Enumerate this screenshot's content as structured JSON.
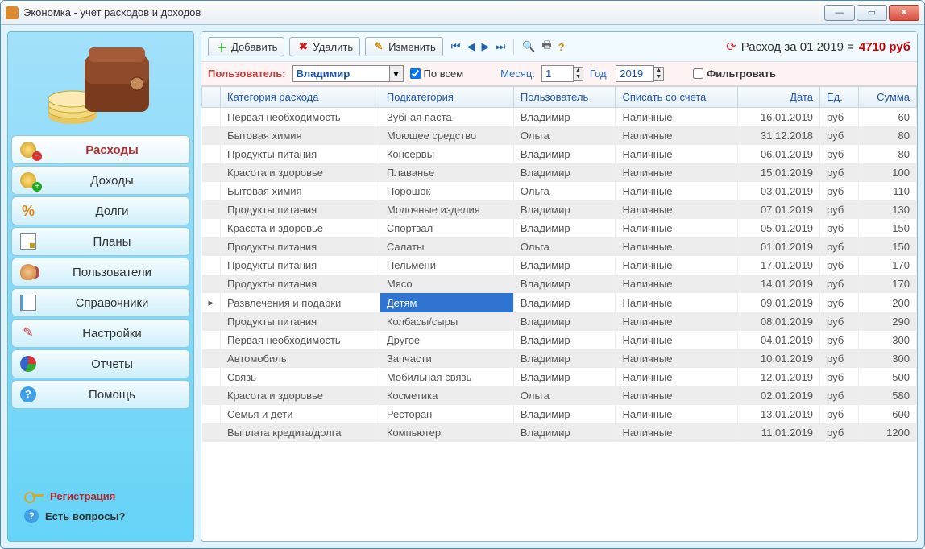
{
  "window": {
    "title": "Экономка - учет расходов и доходов"
  },
  "sidebar": {
    "items": [
      {
        "label": "Расходы",
        "icon": "coins-minus-icon",
        "active": true
      },
      {
        "label": "Доходы",
        "icon": "coins-plus-icon",
        "active": false
      },
      {
        "label": "Долги",
        "icon": "percent-icon",
        "active": false
      },
      {
        "label": "Планы",
        "icon": "document-icon",
        "active": false
      },
      {
        "label": "Пользователи",
        "icon": "users-icon",
        "active": false
      },
      {
        "label": "Справочники",
        "icon": "book-icon",
        "active": false
      },
      {
        "label": "Настройки",
        "icon": "tools-icon",
        "active": false
      },
      {
        "label": "Отчеты",
        "icon": "pie-chart-icon",
        "active": false
      },
      {
        "label": "Помощь",
        "icon": "help-icon",
        "active": false
      }
    ],
    "registration_label": "Регистрация",
    "questions_label": "Есть вопросы?"
  },
  "toolbar": {
    "add_label": "Добавить",
    "delete_label": "Удалить",
    "edit_label": "Изменить",
    "summary_prefix": "Расход за 01.2019 = ",
    "summary_amount": "4710 руб"
  },
  "filter": {
    "user_label": "Пользователь:",
    "user_value": "Владимир",
    "all_label": "По всем",
    "all_checked": true,
    "month_label": "Месяц:",
    "month_value": "1",
    "year_label": "Год:",
    "year_value": "2019",
    "filter_label": "Фильтровать",
    "filter_checked": false
  },
  "table": {
    "columns": [
      "Категория расхода",
      "Подкатегория",
      "Пользователь",
      "Списать со счета",
      "Дата",
      "Ед.",
      "Сумма"
    ],
    "selected_index": 10,
    "rows": [
      {
        "cat": "Первая необходимость",
        "sub": "Зубная паста",
        "user": "Владимир",
        "acc": "Наличные",
        "date": "16.01.2019",
        "unit": "руб",
        "sum": "60"
      },
      {
        "cat": "Бытовая химия",
        "sub": "Моющее средство",
        "user": "Ольга",
        "acc": "Наличные",
        "date": "31.12.2018",
        "unit": "руб",
        "sum": "80"
      },
      {
        "cat": "Продукты питания",
        "sub": "Консервы",
        "user": "Владимир",
        "acc": "Наличные",
        "date": "06.01.2019",
        "unit": "руб",
        "sum": "80"
      },
      {
        "cat": "Красота и здоровье",
        "sub": "Плаванье",
        "user": "Владимир",
        "acc": "Наличные",
        "date": "15.01.2019",
        "unit": "руб",
        "sum": "100"
      },
      {
        "cat": "Бытовая химия",
        "sub": "Порошок",
        "user": "Ольга",
        "acc": "Наличные",
        "date": "03.01.2019",
        "unit": "руб",
        "sum": "110"
      },
      {
        "cat": "Продукты питания",
        "sub": "Молочные изделия",
        "user": "Владимир",
        "acc": "Наличные",
        "date": "07.01.2019",
        "unit": "руб",
        "sum": "130"
      },
      {
        "cat": "Красота и здоровье",
        "sub": "Спортзал",
        "user": "Владимир",
        "acc": "Наличные",
        "date": "05.01.2019",
        "unit": "руб",
        "sum": "150"
      },
      {
        "cat": "Продукты питания",
        "sub": "Салаты",
        "user": "Ольга",
        "acc": "Наличные",
        "date": "01.01.2019",
        "unit": "руб",
        "sum": "150"
      },
      {
        "cat": "Продукты питания",
        "sub": "Пельмени",
        "user": "Владимир",
        "acc": "Наличные",
        "date": "17.01.2019",
        "unit": "руб",
        "sum": "170"
      },
      {
        "cat": "Продукты питания",
        "sub": "Мясо",
        "user": "Владимир",
        "acc": "Наличные",
        "date": "14.01.2019",
        "unit": "руб",
        "sum": "170"
      },
      {
        "cat": "Развлечения и подарки",
        "sub": "Детям",
        "user": "Владимир",
        "acc": "Наличные",
        "date": "09.01.2019",
        "unit": "руб",
        "sum": "200"
      },
      {
        "cat": "Продукты питания",
        "sub": "Колбасы/сыры",
        "user": "Владимир",
        "acc": "Наличные",
        "date": "08.01.2019",
        "unit": "руб",
        "sum": "290"
      },
      {
        "cat": "Первая необходимость",
        "sub": "Другое",
        "user": "Владимир",
        "acc": "Наличные",
        "date": "04.01.2019",
        "unit": "руб",
        "sum": "300"
      },
      {
        "cat": "Автомобиль",
        "sub": "Запчасти",
        "user": "Владимир",
        "acc": "Наличные",
        "date": "10.01.2019",
        "unit": "руб",
        "sum": "300"
      },
      {
        "cat": "Связь",
        "sub": "Мобильная связь",
        "user": "Владимир",
        "acc": "Наличные",
        "date": "12.01.2019",
        "unit": "руб",
        "sum": "500"
      },
      {
        "cat": "Красота и здоровье",
        "sub": "Косметика",
        "user": "Ольга",
        "acc": "Наличные",
        "date": "02.01.2019",
        "unit": "руб",
        "sum": "580"
      },
      {
        "cat": "Семья и дети",
        "sub": "Ресторан",
        "user": "Владимир",
        "acc": "Наличные",
        "date": "13.01.2019",
        "unit": "руб",
        "sum": "600"
      },
      {
        "cat": "Выплата кредита/долга",
        "sub": "Компьютер",
        "user": "Владимир",
        "acc": "Наличные",
        "date": "11.01.2019",
        "unit": "руб",
        "sum": "1200"
      }
    ]
  }
}
